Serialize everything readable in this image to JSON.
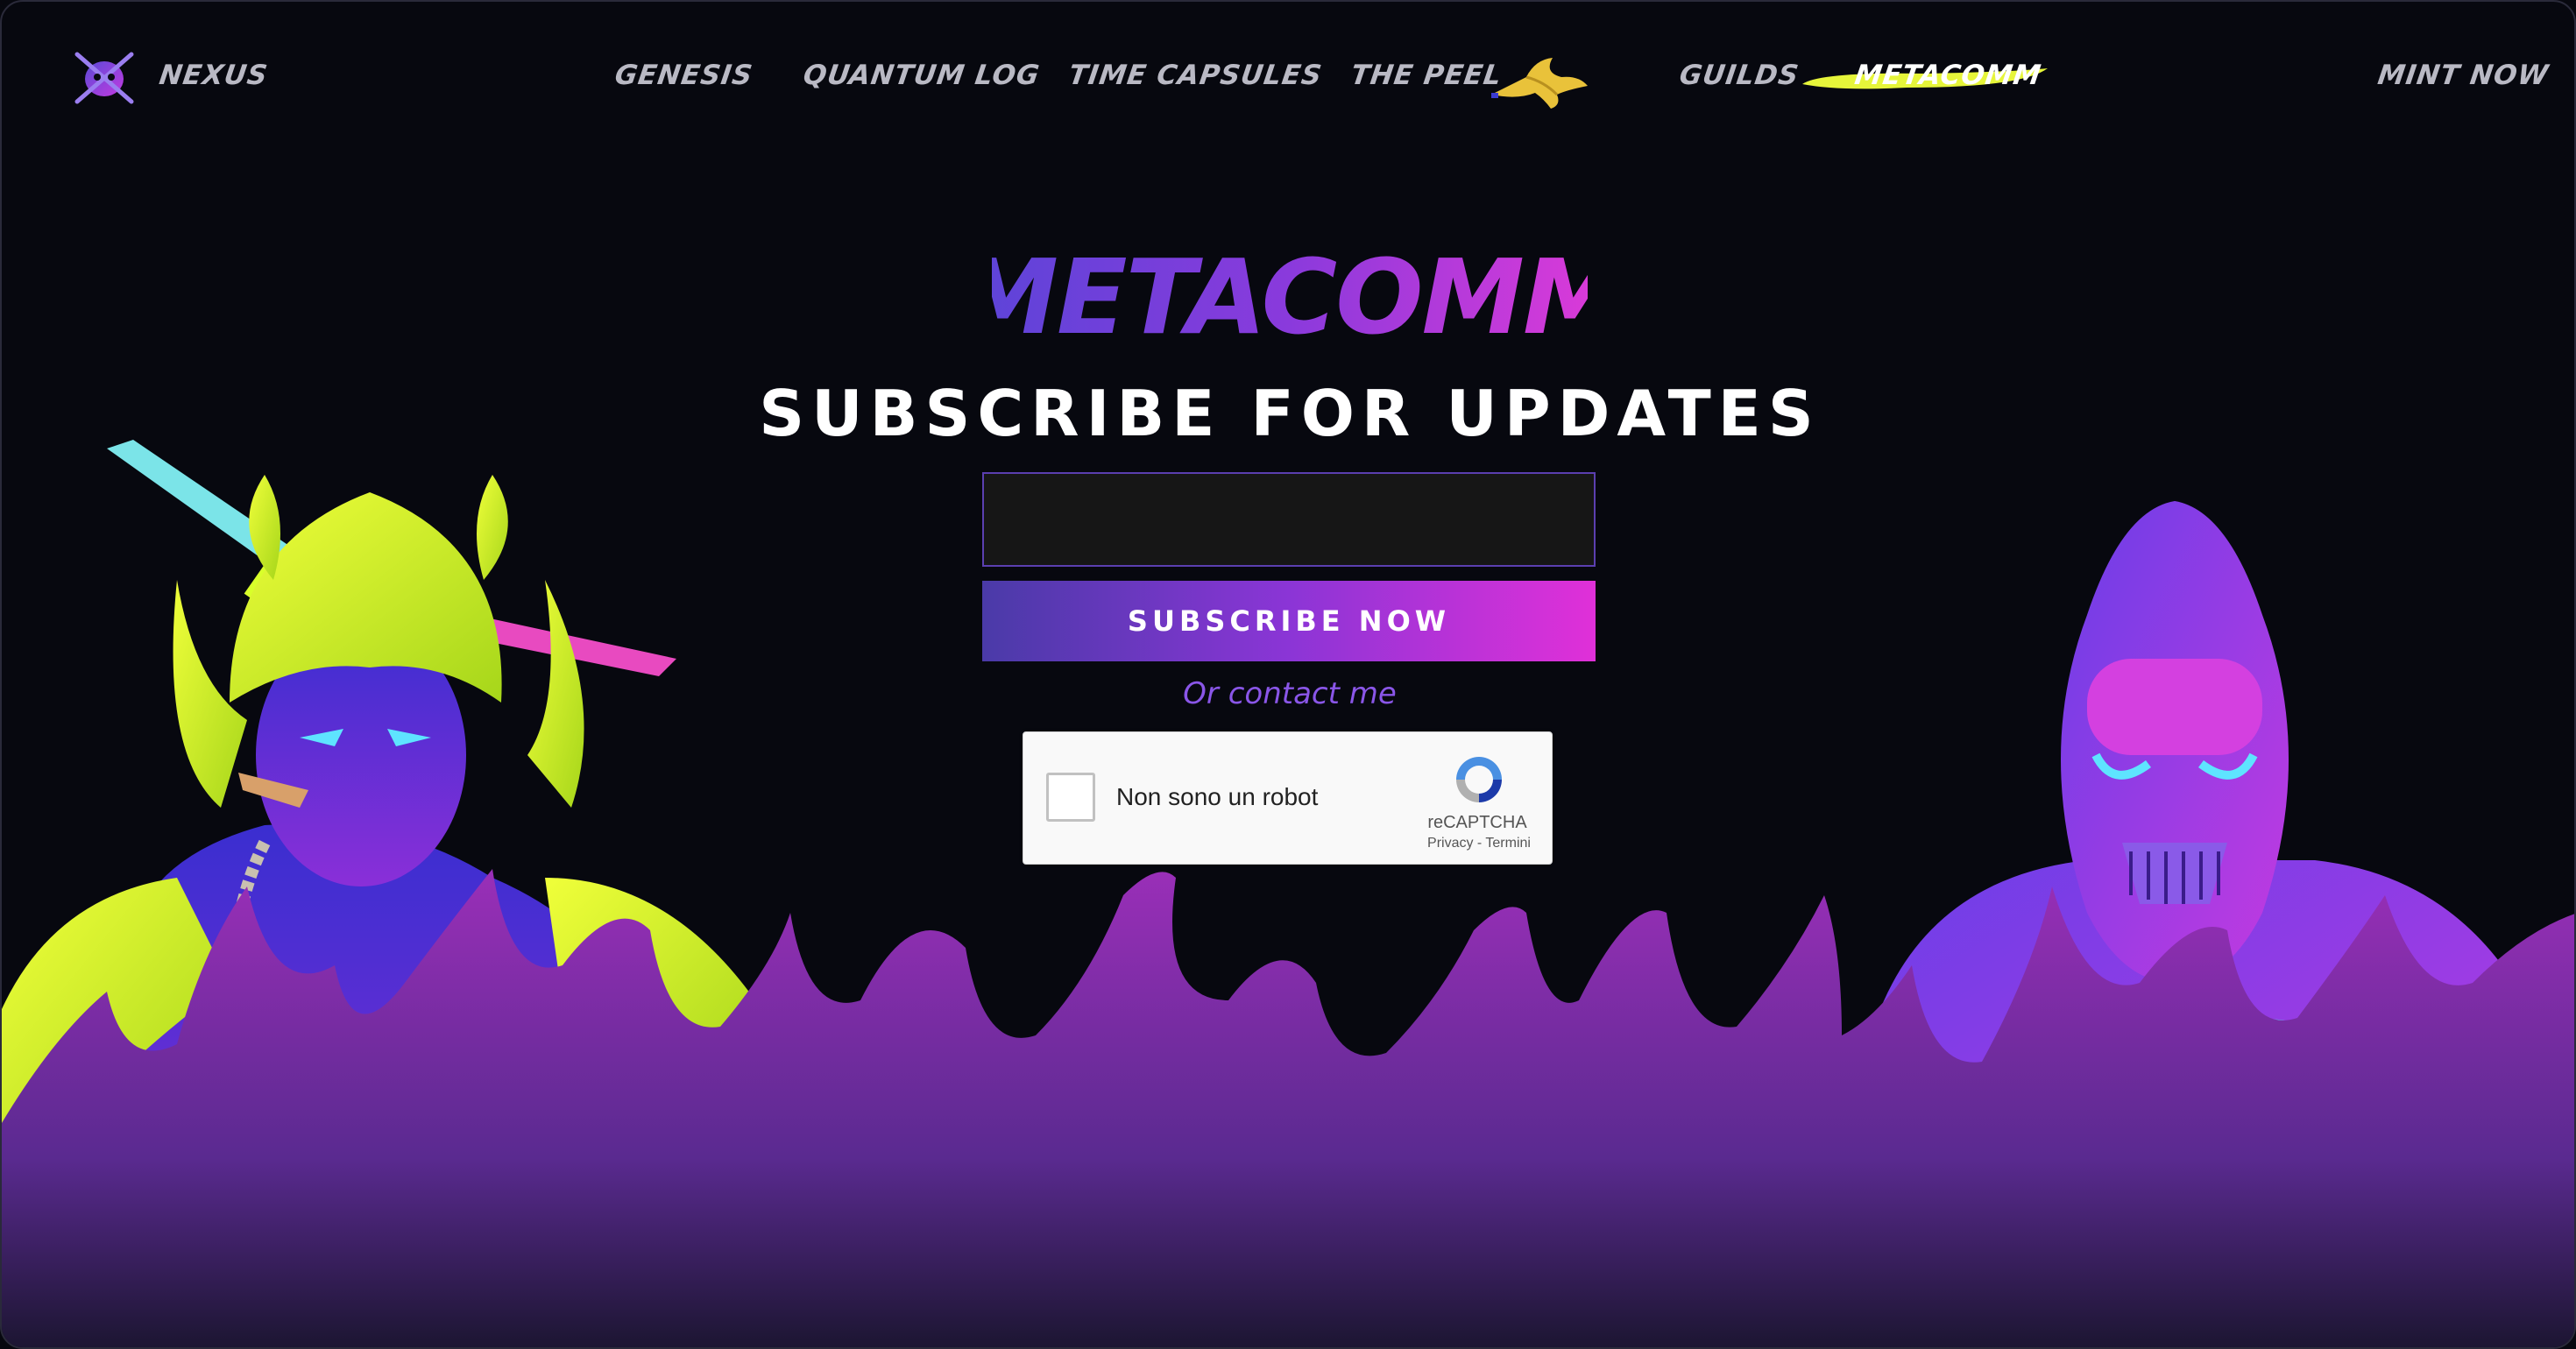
{
  "nav": {
    "brand": "NEXUS",
    "items": [
      {
        "label": "GENESIS"
      },
      {
        "label": "QUANTUM LOG"
      },
      {
        "label": "TIME CAPSULES"
      },
      {
        "label": "THE PEEL"
      },
      {
        "label": "GUILDS"
      },
      {
        "label": "METACOMM"
      }
    ],
    "cta": "MINT NOW",
    "active": "METACOMM"
  },
  "hero": {
    "logo_text": "METACOMM",
    "heading": "SUBSCRIBE FOR UPDATES",
    "email_value": "",
    "button_label": "SUBSCRIBE NOW",
    "contact_label": "Or contact me"
  },
  "recaptcha": {
    "label": "Non sono un robot",
    "brand": "reCAPTCHA",
    "links": "Privacy - Termini"
  },
  "colors": {
    "background": "#07080f",
    "accent_purple": "#8a56e8",
    "accent_pink": "#e030d8",
    "accent_yellow": "#e6f53a"
  }
}
